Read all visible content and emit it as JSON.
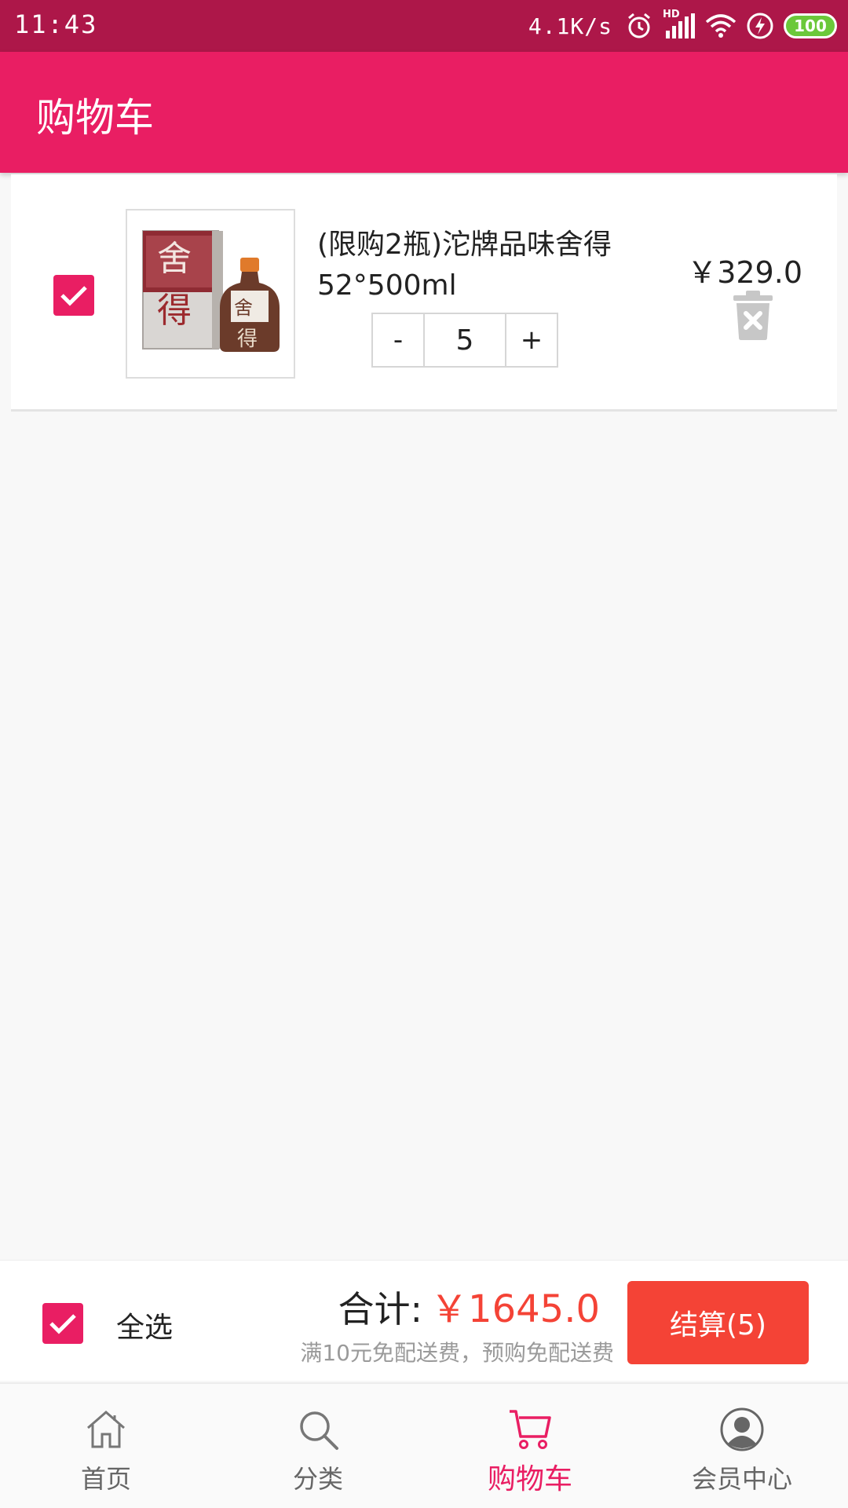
{
  "status_bar": {
    "time": "11:43",
    "net_speed": "4.1K/s",
    "battery": "100",
    "hd_label": "HD"
  },
  "app_bar": {
    "title": "购物车"
  },
  "cart_items": [
    {
      "name": "(限购2瓶)沱牌品味舍得52°500ml",
      "quantity": "5",
      "price": "￥329.0",
      "checked": true,
      "minus_label": "-",
      "plus_label": "+",
      "product_image_text": [
        "舍",
        "得"
      ]
    }
  ],
  "checkout": {
    "select_all_label": "全选",
    "total_label": "合计:",
    "total_value": "￥1645.0",
    "delivery_note": "满10元免配送费，预购免配送费",
    "settle_button": "结算(5)"
  },
  "bottom_nav": {
    "items": [
      {
        "label": "首页",
        "icon": "home-icon",
        "active": false
      },
      {
        "label": "分类",
        "icon": "search-icon",
        "active": false
      },
      {
        "label": "购物车",
        "icon": "cart-icon",
        "active": true
      },
      {
        "label": "会员中心",
        "icon": "user-icon",
        "active": false
      }
    ]
  },
  "colors": {
    "primary": "#e91e63",
    "status_bar": "#ad1749",
    "accent_red": "#f44336",
    "battery_green": "#6bc83a"
  }
}
